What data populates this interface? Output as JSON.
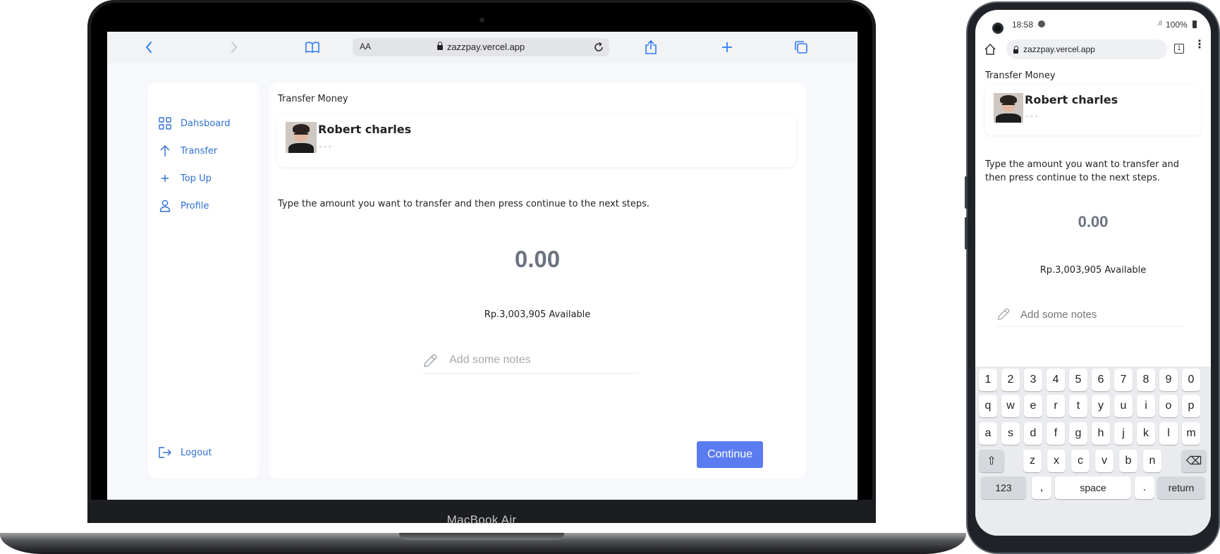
{
  "laptop": {
    "brand_label": "MacBook Air",
    "browser": {
      "text_size_label": "AA",
      "url": "zazzpay.vercel.app"
    },
    "sidebar": {
      "items": [
        {
          "label": "Dahsboard",
          "icon": "grid-icon"
        },
        {
          "label": "Transfer",
          "icon": "arrow-up-icon"
        },
        {
          "label": "Top Up",
          "icon": "plus-icon"
        },
        {
          "label": "Profile",
          "icon": "user-icon"
        }
      ],
      "logout_label": "Logout"
    },
    "main": {
      "title": "Transfer Money",
      "recipient": {
        "name": "Robert charles",
        "phone": "---"
      },
      "instruction": "Type the amount you want to transfer and then press continue to the next steps.",
      "amount": "0.00",
      "available": "Rp.3,003,905 Available",
      "notes_placeholder": "Add some notes",
      "continue_label": "Continue"
    },
    "colors": {
      "accent": "#2f6fd4",
      "button": "#5b7cf0",
      "amount": "#6b7280",
      "background": "#f6f8fc"
    }
  },
  "phone": {
    "status": {
      "time": "18:58",
      "battery": "100%"
    },
    "browser": {
      "url": "zazzpay.vercel.app",
      "tab_count": "1"
    },
    "main": {
      "title": "Transfer Money",
      "recipient": {
        "name": "Robert charles",
        "phone": "---"
      },
      "instruction": "Type the amount you want to transfer and then press continue to the next steps.",
      "amount": "0.00",
      "available": "Rp.3,003,905 Available",
      "notes_placeholder": "Add some notes"
    },
    "keyboard": {
      "row1": [
        "1",
        "2",
        "3",
        "4",
        "5",
        "6",
        "7",
        "8",
        "9",
        "0"
      ],
      "row2": [
        "q",
        "w",
        "e",
        "r",
        "t",
        "y",
        "u",
        "i",
        "o",
        "p"
      ],
      "row3": [
        "a",
        "s",
        "d",
        "f",
        "g",
        "h",
        "j",
        "k",
        "l",
        "m"
      ],
      "row4": [
        "z",
        "x",
        "c",
        "v",
        "b",
        "n"
      ],
      "shift": "⇧",
      "backspace": "⌫",
      "numbers": "123",
      "comma": ",",
      "space": "space",
      "period": ".",
      "return": "return"
    }
  }
}
